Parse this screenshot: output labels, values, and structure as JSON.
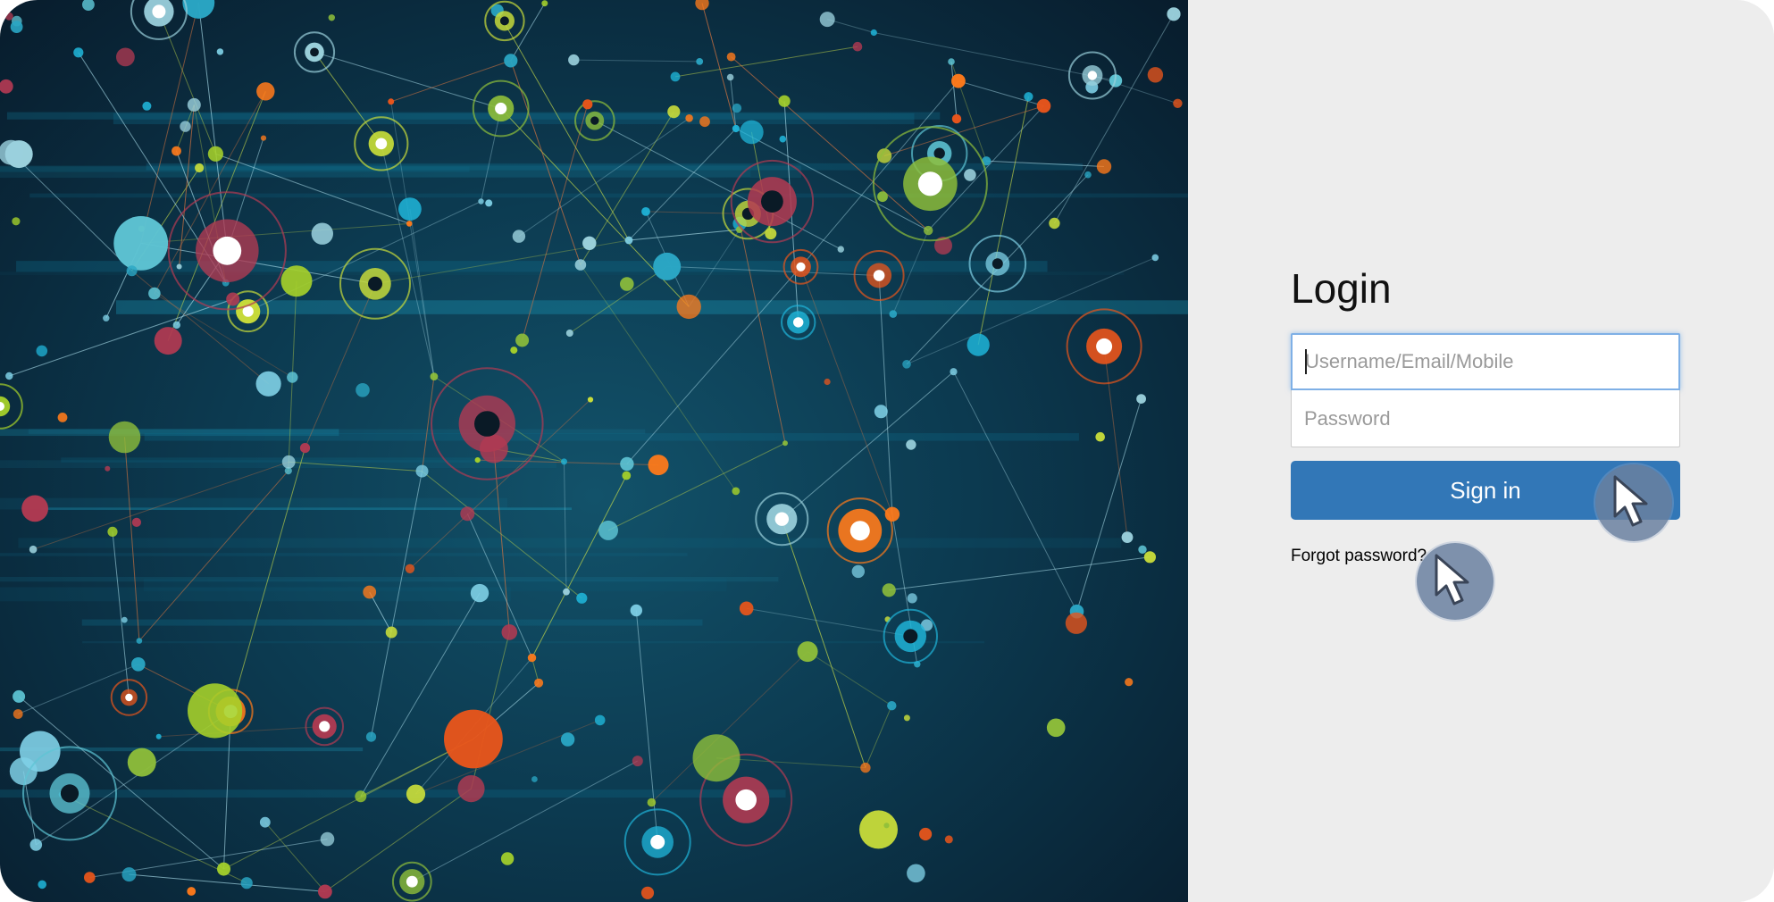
{
  "login": {
    "title": "Login",
    "username_placeholder": "Username/Email/Mobile",
    "password_placeholder": "Password",
    "sign_in_label": "Sign in",
    "forgot_password_label": "Forgot password?"
  },
  "colors": {
    "primary_button": "#3277b7",
    "panel_background": "#ededed",
    "focus_border": "#7fb0e6"
  },
  "icons": [
    "mouse-pointer-icon",
    "mouse-pointer-icon"
  ]
}
